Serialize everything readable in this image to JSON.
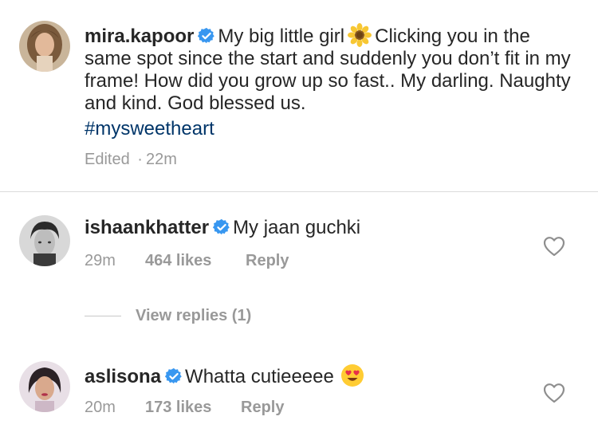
{
  "caption": {
    "username": "mira.kapoor",
    "text_before_emoji": "My big little girl",
    "emoji": "sunflower-emoji",
    "text_after_emoji": "Clicking you in the same spot since the start and suddenly you don’t fit in my frame! How did you grow up so fast.. My darling. Naughty and kind. God blessed us.",
    "hashtag": "#mysweetheart",
    "edited": "Edited",
    "separator": "·",
    "time": "22m"
  },
  "comments": [
    {
      "username": "ishaankhatter",
      "text": "My jaan guchki",
      "time": "29m",
      "likes": "464 likes",
      "reply_label": "Reply",
      "view_replies": "View replies (1)"
    },
    {
      "username": "aslisona",
      "text": "Whatta cutieeeee",
      "emoji": "heart-eyes-emoji",
      "time": "20m",
      "likes": "173 likes",
      "reply_label": "Reply"
    }
  ],
  "colors": {
    "text": "#262626",
    "meta": "#999999",
    "hashtag": "#003569",
    "verified": "#3897f0",
    "divider": "#dbdbdb"
  }
}
